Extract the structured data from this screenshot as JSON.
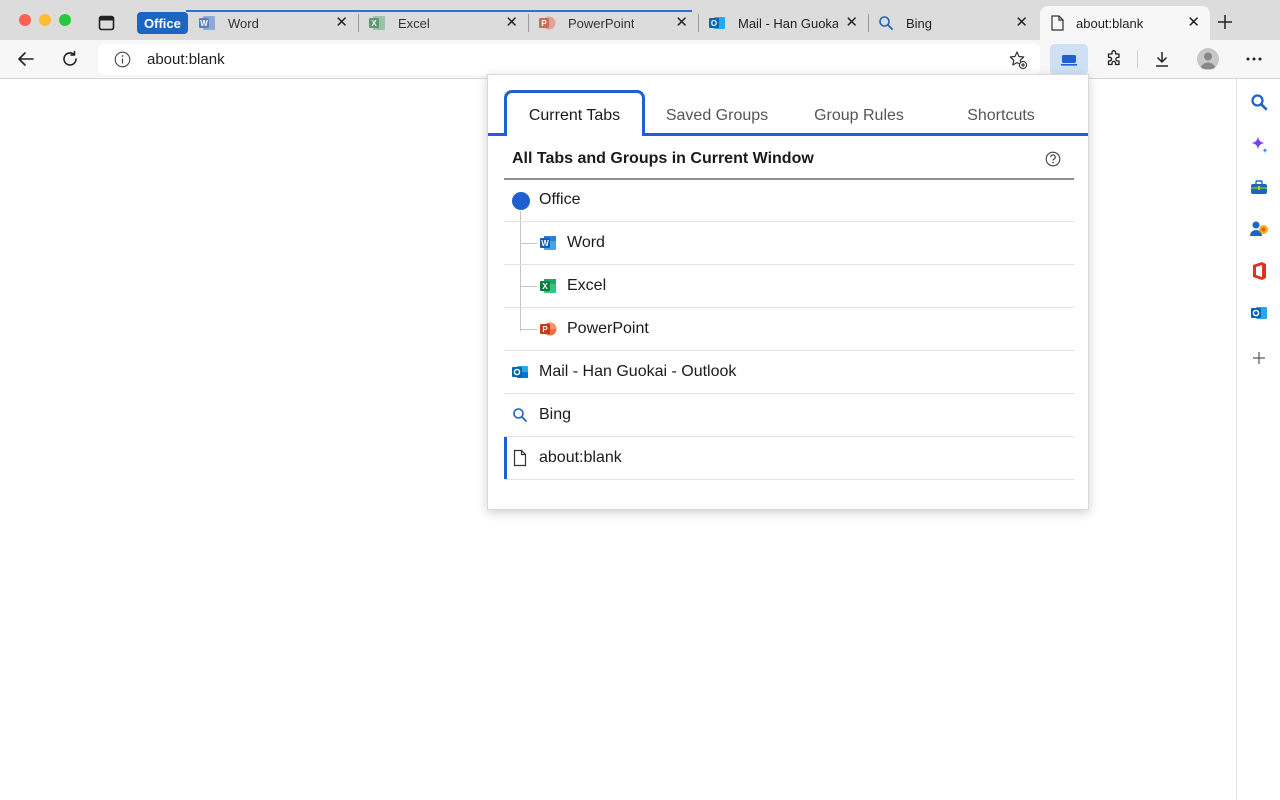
{
  "browser": {
    "tabs": [
      {
        "label": "Word",
        "icon": "word-icon"
      },
      {
        "label": "Excel",
        "icon": "excel-icon"
      },
      {
        "label": "PowerPoint",
        "icon": "powerpoint-icon"
      },
      {
        "label": "Mail - Han Guokai",
        "icon": "outlook-icon"
      },
      {
        "label": "Bing",
        "icon": "search-icon"
      },
      {
        "label": "about:blank",
        "icon": "document-icon"
      }
    ],
    "group_label": "Office",
    "group_color": "#1a66c2",
    "address": "about:blank"
  },
  "popup": {
    "tabs": [
      "Current Tabs",
      "Saved Groups",
      "Group Rules",
      "Shortcuts"
    ],
    "active_tab": "Current Tabs",
    "heading": "All Tabs and Groups in Current Window",
    "accent": "#1f5fd1",
    "items": [
      {
        "label": "Office",
        "type": "group",
        "icon": "group-dot-icon"
      },
      {
        "label": "Word",
        "type": "child",
        "icon": "word-icon"
      },
      {
        "label": "Excel",
        "type": "child",
        "icon": "excel-icon"
      },
      {
        "label": "PowerPoint",
        "type": "child",
        "icon": "powerpoint-icon"
      },
      {
        "label": "Mail - Han Guokai - Outlook",
        "type": "tab",
        "icon": "outlook-icon"
      },
      {
        "label": "Bing",
        "type": "tab",
        "icon": "search-icon"
      },
      {
        "label": "about:blank",
        "type": "tab",
        "icon": "document-icon",
        "current": true
      }
    ]
  }
}
